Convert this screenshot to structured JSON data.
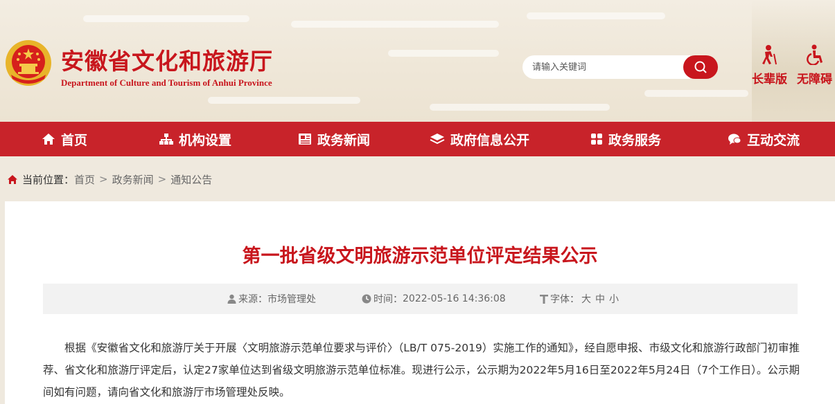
{
  "header": {
    "title": "安徽省文化和旅游厅",
    "subtitle": "Department of Culture and Tourism of Anhui Province",
    "search_placeholder": "请输入关键词",
    "tools": [
      {
        "label": "长辈版",
        "icon": "elder-mode-icon"
      },
      {
        "label": "无障碍",
        "icon": "accessibility-icon"
      }
    ]
  },
  "nav": {
    "items": [
      {
        "label": "首页",
        "icon": "home-icon"
      },
      {
        "label": "机构设置",
        "icon": "org-chart-icon"
      },
      {
        "label": "政务新闻",
        "icon": "newspaper-icon"
      },
      {
        "label": "政府信息公开",
        "icon": "layers-icon"
      },
      {
        "label": "政务服务",
        "icon": "grid-icon"
      },
      {
        "label": "互动交流",
        "icon": "chat-icon"
      }
    ]
  },
  "breadcrumb": {
    "label": "当前位置：",
    "items": [
      "首页",
      "政务新闻",
      "通知公告"
    ],
    "separator": ">"
  },
  "article": {
    "title": "第一批省级文明旅游示范单位评定结果公示",
    "source_label": "来源：",
    "source": "市场管理处",
    "time_label": "时间：",
    "time": "2022-05-16 14:36:08",
    "font_label": "字体：",
    "font_sizes": [
      "大",
      "中",
      "小"
    ],
    "body": "根据《安徽省文化和旅游厅关于开展〈文明旅游示范单位要求与评价〉（LB/T 075-2019）实施工作的通知》，经自愿申报、市级文化和旅游行政部门初审推荐、省文化和旅游厅评定后，认定27家单位达到省级文明旅游示范单位标准。现进行公示，公示期为2022年5月16日至2022年5月24日（7个工作日）。公示期间如有问题，请向省文化和旅游厅市场管理处反映。"
  },
  "colors": {
    "brand_red": "#c8161d",
    "nav_red": "#c8232a",
    "header_bg": "#efe7d8"
  }
}
